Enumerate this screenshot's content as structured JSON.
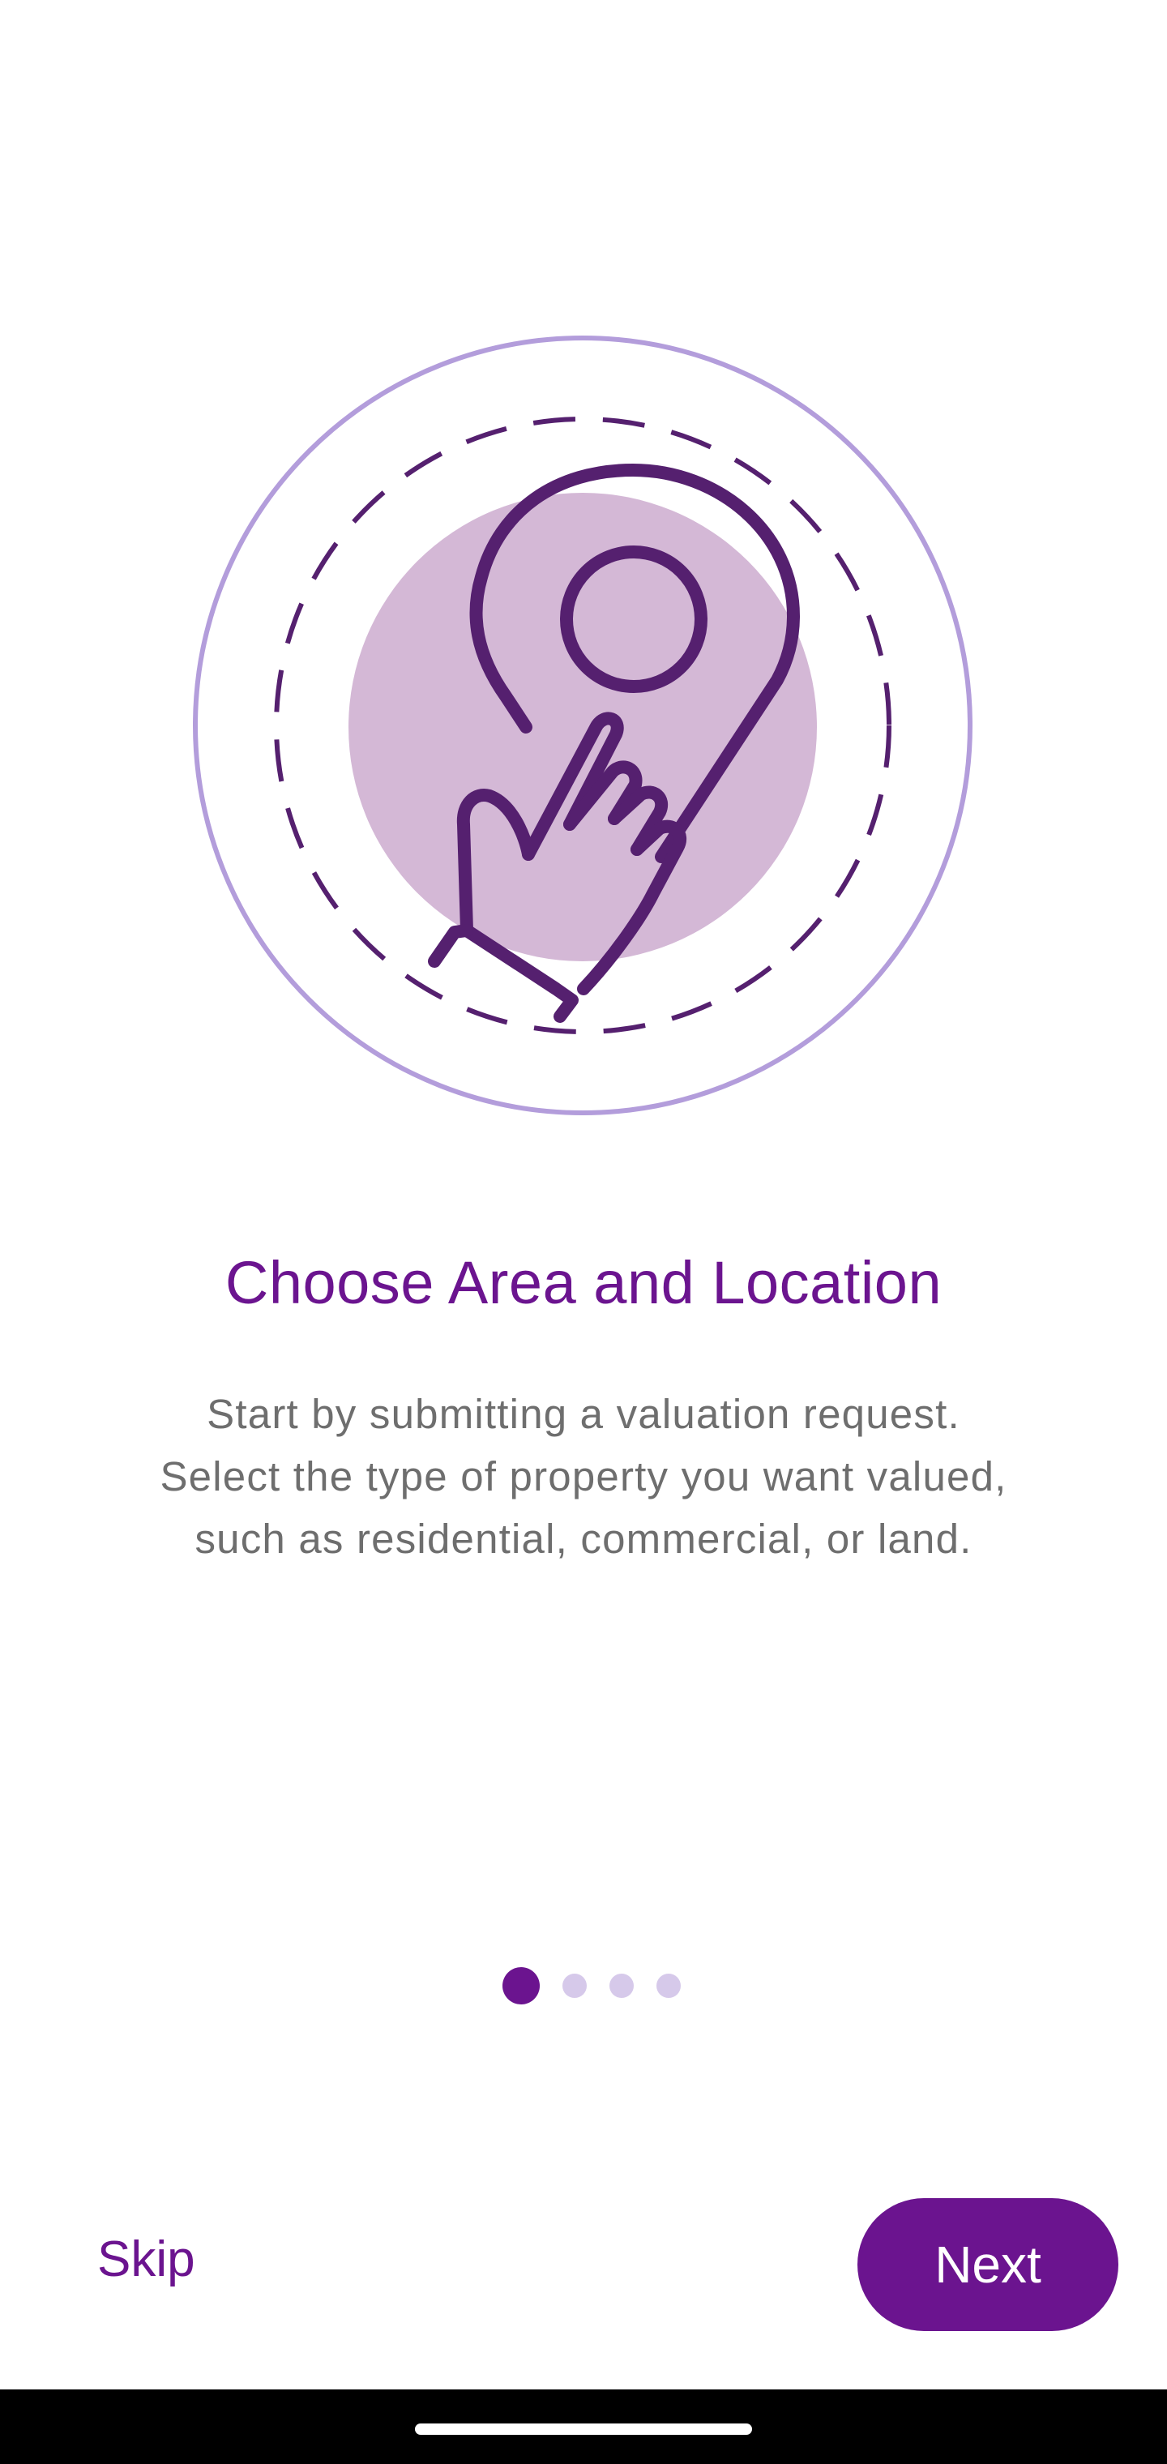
{
  "onboarding": {
    "title": "Choose Area and Location",
    "description_lines": [
      "Start by submitting a valuation request.",
      "Select the type of property you want valued,",
      "such as residential, commercial, or land."
    ],
    "illustration_icon": "hand-tap-location-pin-icon",
    "pager": {
      "total": 4,
      "active_index": 0
    }
  },
  "actions": {
    "skip_label": "Skip",
    "next_label": "Next"
  },
  "colors": {
    "primary": "#6b148f",
    "outer_ring": "#b39ddb",
    "blob": "#d4b8d6",
    "icon_stroke": "#55206f",
    "text_secondary": "#6e6e6e",
    "dot_inactive": "#d6c9ea"
  }
}
